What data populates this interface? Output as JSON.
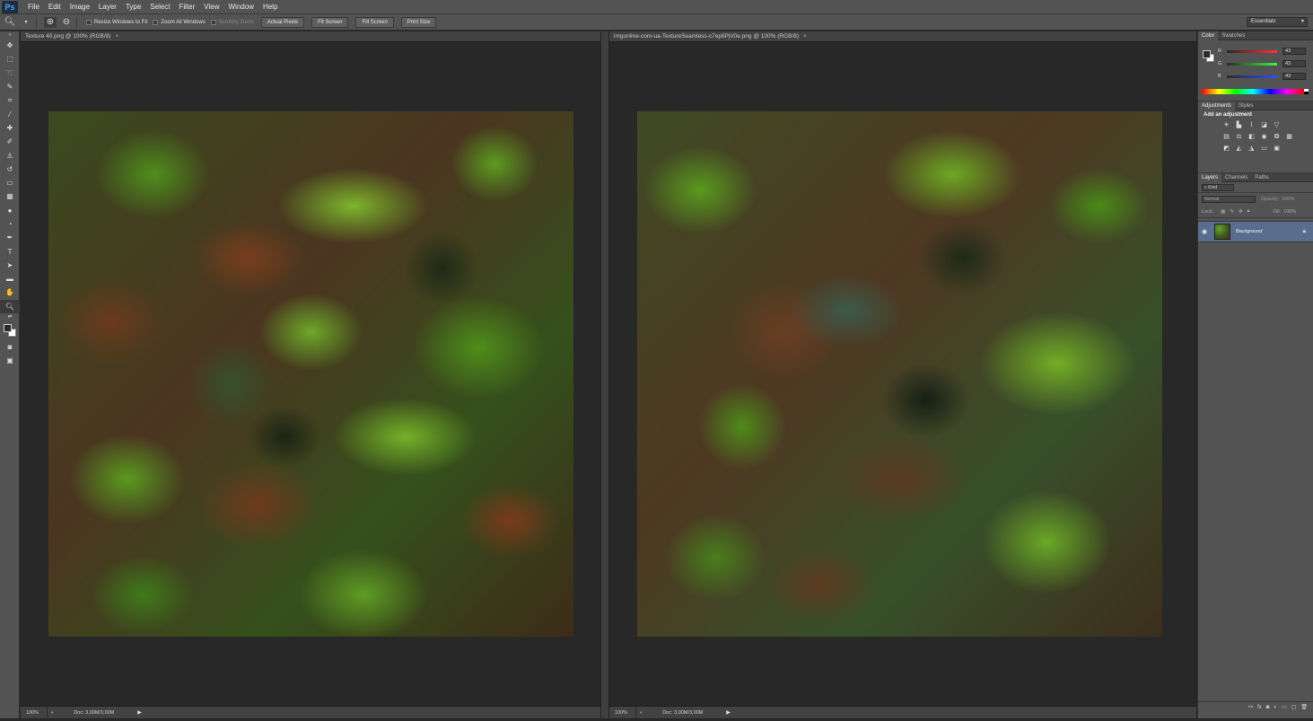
{
  "menubar": {
    "logo": "Ps",
    "items": [
      "File",
      "Edit",
      "Image",
      "Layer",
      "Type",
      "Select",
      "Filter",
      "View",
      "Window",
      "Help"
    ]
  },
  "options": {
    "resize_windows": "Resize Windows to Fit",
    "zoom_all": "Zoom All Windows",
    "scrubby_zoom": "Scrubby Zoom",
    "buttons": [
      "Actual Pixels",
      "Fit Screen",
      "Fill Screen",
      "Print Size"
    ],
    "workspace": "Essentials"
  },
  "documents": [
    {
      "tab": "Texture 40.png @ 100% (RGB/8)",
      "zoom": "100%",
      "docinfo": "Doc: 3,00M/3,00M"
    },
    {
      "tab": "imgonline-com-ua-TextureSeamless-c7ep8PjV0e.png @ 100% (RGB/8)",
      "zoom": "100%",
      "docinfo": "Doc: 3,00M/3,00M"
    }
  ],
  "color_panel": {
    "tabs": [
      "Color",
      "Swatches"
    ],
    "r": "43",
    "g": "43",
    "b": "43"
  },
  "adjustments_panel": {
    "tabs": [
      "Adjustments",
      "Styles"
    ],
    "title": "Add an adjustment"
  },
  "layers_panel": {
    "tabs": [
      "Layers",
      "Channels",
      "Paths"
    ],
    "kind": "Kind",
    "blend_mode": "Normal",
    "opacity_label": "Opacity:",
    "opacity": "100%",
    "lock_label": "Lock:",
    "fill_label": "Fill:",
    "fill": "100%",
    "layer_name": "Background"
  },
  "colors": {
    "ui_bg": "#535353",
    "canvas_bg": "#282828",
    "selected_layer": "#596d8f"
  }
}
